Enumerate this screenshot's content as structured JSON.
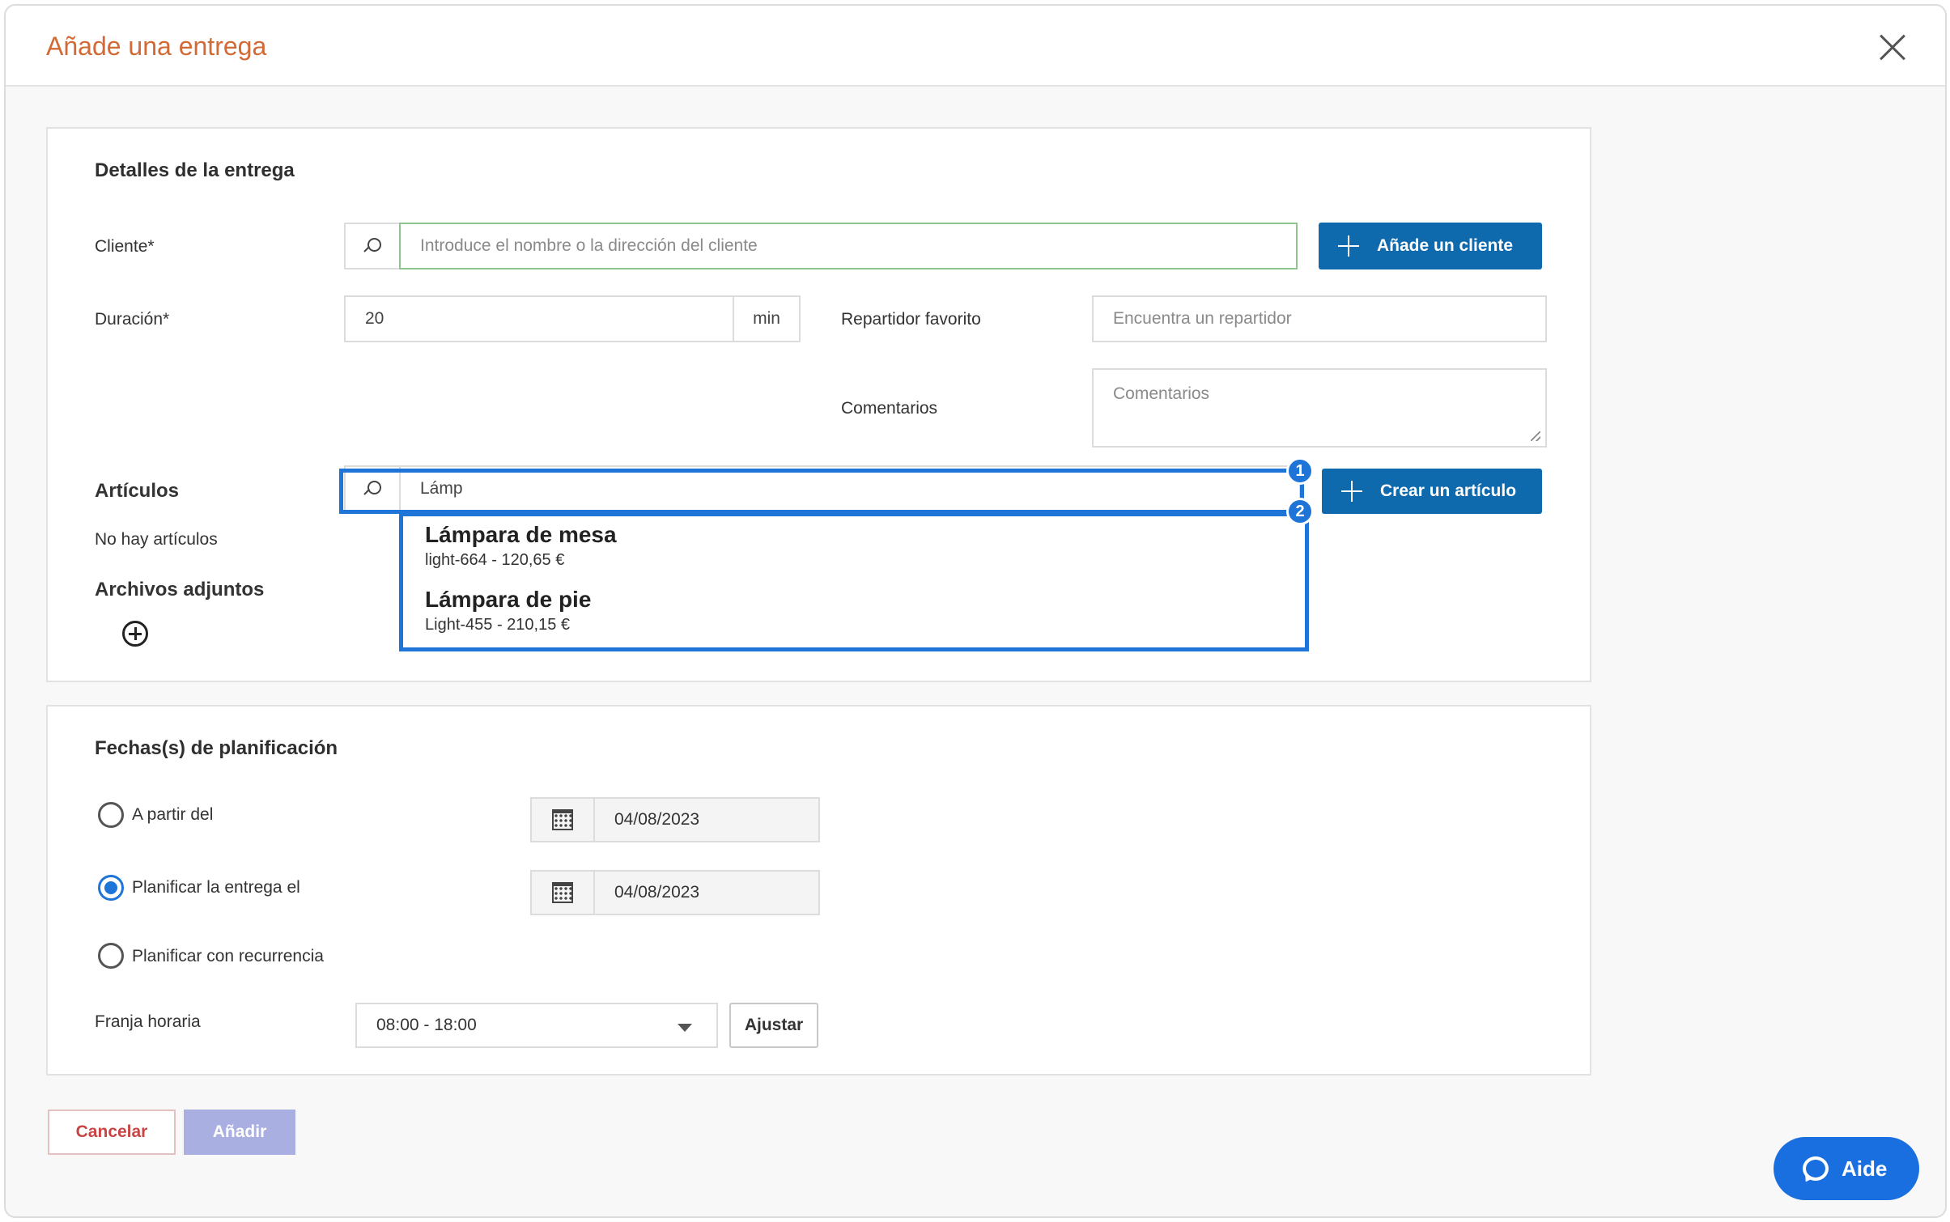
{
  "modal": {
    "title": "Añade una entrega"
  },
  "details": {
    "section_title": "Detalles de la entrega",
    "client_label": "Cliente*",
    "client_placeholder": "Introduce el nombre o la dirección del cliente",
    "add_client_label": "Añade un cliente",
    "duration_label": "Duración*",
    "duration_value": "20",
    "duration_unit": "min",
    "driver_label": "Repartidor favorito",
    "driver_placeholder": "Encuentra un repartidor",
    "comments_label": "Comentarios",
    "comments_placeholder": "Comentarios",
    "items_label": "Artículos",
    "items_search_value": "Lámp",
    "create_item_label": "Crear un artículo",
    "no_items_text": "No hay artículos",
    "attachments_label": "Archivos adjuntos",
    "suggestions": [
      {
        "name": "Lámpara de mesa",
        "detail": "light-664 - 120,65 €"
      },
      {
        "name": "Lámpara de pie",
        "detail": "Light-455 - 210,15 €"
      }
    ],
    "annotations": [
      "1",
      "2"
    ]
  },
  "planning": {
    "section_title": "Fechas(s) de planificación",
    "options": [
      {
        "label": "A partir del",
        "selected": false,
        "date": "04/08/2023"
      },
      {
        "label": "Planificar la entrega el",
        "selected": true,
        "date": "04/08/2023"
      },
      {
        "label": "Planificar con recurrencia",
        "selected": false
      }
    ],
    "time_slot_label": "Franja horaria",
    "time_slot_value": "08:00 - 18:00",
    "adjust_label": "Ajustar"
  },
  "footer": {
    "cancel_label": "Cancelar",
    "add_label": "Añadir"
  },
  "help": {
    "label": "Aide"
  },
  "colors": {
    "title": "#d26a35",
    "primary": "#0f6aad",
    "highlight": "#1e74d7",
    "help": "#1a6fe0",
    "add_disabled": "#a9afe0",
    "cancel": "#c94545"
  }
}
